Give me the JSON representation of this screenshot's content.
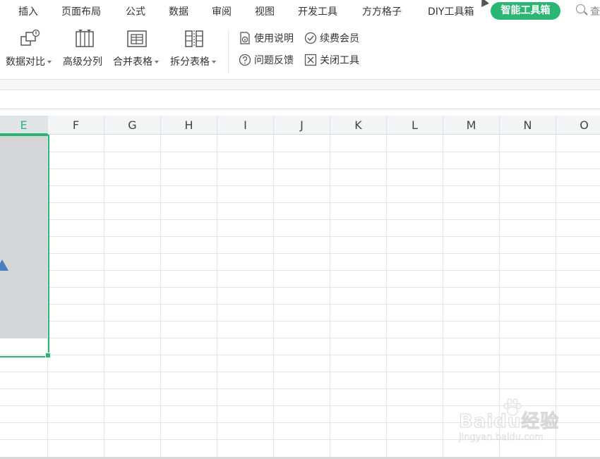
{
  "menu": {
    "items": [
      "插入",
      "页面布局",
      "公式",
      "数据",
      "审阅",
      "视图",
      "开发工具",
      "方方格子",
      "DIY工具箱"
    ],
    "active": "智能工具箱",
    "search_label": "查"
  },
  "ribbon": {
    "tools": [
      {
        "label": "数据对比",
        "icon": "compare-icon",
        "dropdown": true
      },
      {
        "label": "高级分列",
        "icon": "split-columns-icon",
        "dropdown": false
      },
      {
        "label": "合并表格",
        "icon": "merge-table-icon",
        "dropdown": true
      },
      {
        "label": "拆分表格",
        "icon": "split-table-icon",
        "dropdown": true
      }
    ],
    "small_tools": [
      {
        "label": "使用说明",
        "icon": "manual-icon"
      },
      {
        "label": "续费会员",
        "icon": "check-circle-icon"
      },
      {
        "label": "问题反馈",
        "icon": "question-icon"
      },
      {
        "label": "关闭工具",
        "icon": "close-box-icon"
      }
    ]
  },
  "sheet": {
    "columns": [
      "E",
      "F",
      "G",
      "H",
      "I",
      "J",
      "K",
      "L",
      "M",
      "N",
      "O"
    ],
    "selected_column": "E"
  },
  "watermark": {
    "text": "Baidu经验",
    "url": "jingyan.baidu.com"
  },
  "colors": {
    "accent": "#2bb673",
    "selection_fill": "#d4d6d8",
    "shape": "#4a7fc1"
  }
}
